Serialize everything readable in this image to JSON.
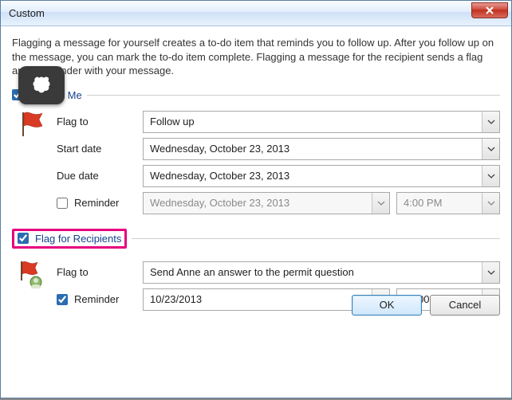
{
  "window": {
    "title": "Custom"
  },
  "description": "Flagging a message for yourself creates a to-do item that reminds you to follow up. After you follow up on the message, you can mark the to-do item complete. Flagging a message for the recipient sends a flag and a reminder with your message.",
  "section_me": {
    "checked": true,
    "label": "Flag for Me",
    "flag_to_label": "Flag to",
    "flag_to_value": "Follow up",
    "start_label": "Start date",
    "start_value": "Wednesday, October 23, 2013",
    "due_label": "Due date",
    "due_value": "Wednesday, October 23, 2013",
    "reminder_label": "Reminder",
    "reminder_checked": false,
    "reminder_date": "Wednesday, October 23, 2013",
    "reminder_time": "4:00 PM"
  },
  "section_rec": {
    "checked": true,
    "label": "Flag for Recipients",
    "flag_to_label": "Flag to",
    "flag_to_value": "Send Anne an answer to the permit question",
    "reminder_label": "Reminder",
    "reminder_checked": true,
    "reminder_date": "10/23/2013",
    "reminder_time": "10:00 AM"
  },
  "buttons": {
    "ok": "OK",
    "cancel": "Cancel"
  }
}
